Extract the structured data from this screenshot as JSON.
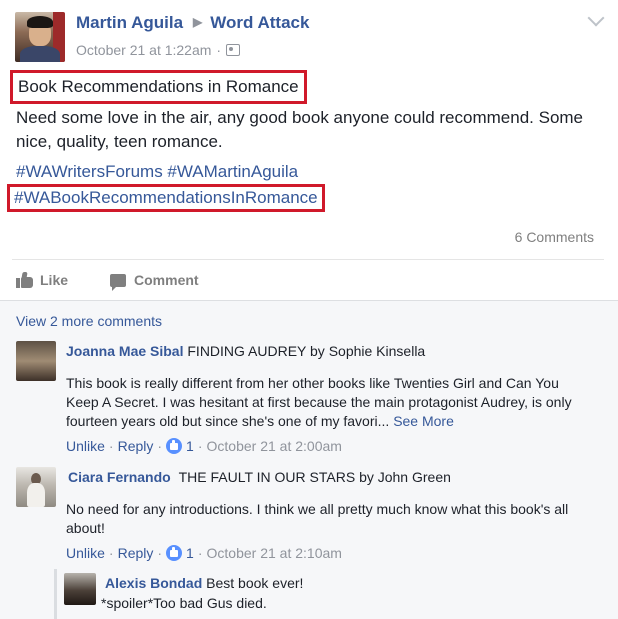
{
  "post": {
    "author": "Martin Aguila",
    "group": "Word Attack",
    "timestamp": "October 21 at 1:22am",
    "title": "Book Recommendations in Romance",
    "body": "Need some love in the air, any good book anyone could recommend. Some nice, quality, teen romance.",
    "hashtags_line1": "#WAWritersForums #WAMartinAguila",
    "hashtags_line2": "#WABookRecommendationsInRomance",
    "comment_count": "6 Comments"
  },
  "actions": {
    "like_label": "Like",
    "comment_label": "Comment"
  },
  "comments_section": {
    "view_more": "View 2 more comments",
    "items": [
      {
        "author": "Joanna Mae Sibal",
        "text_inline": "FINDING AUDREY by Sophie Kinsella",
        "text_body": "This book is really different from her other books like Twenties Girl and Can You Keep A Secret. I was hesitant at first because the main protagonist Audrey, is only fourteen years old but since she's one of my favori...",
        "see_more": "See More",
        "unlike": "Unlike",
        "reply": "Reply",
        "likes": "1",
        "time": "October 21 at 2:00am"
      },
      {
        "author": "Ciara Fernando",
        "text_inline": "THE FAULT IN OUR STARS by John Green",
        "text_body": "No need for any introductions. I think we all pretty much know what this book's all about!",
        "unlike": "Unlike",
        "reply": "Reply",
        "likes": "1",
        "time": "October 21 at 2:10am"
      }
    ],
    "reply": {
      "author": "Alexis Bondad",
      "text_inline": "Best book ever!",
      "text_body": "*spoiler*Too bad Gus died."
    }
  },
  "colors": {
    "link": "#365899",
    "highlight_box": "#d0192a",
    "muted": "#90949c",
    "like_badge": "#5890ff"
  },
  "icons": [
    "chevron-down-icon",
    "audience-icon",
    "like-icon",
    "comment-icon",
    "like-badge-icon"
  ]
}
